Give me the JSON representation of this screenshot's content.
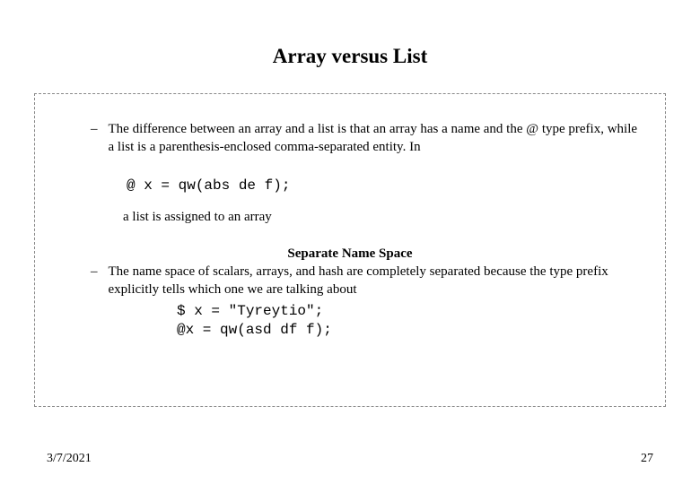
{
  "title": "Array versus List",
  "bullet1": {
    "dash": "–",
    "text": "The difference between an array and a list is that an array has a name and the @ type prefix, while a list is a parenthesis-enclosed comma-separated entity. In"
  },
  "code1": "@ x = qw(abs de f);",
  "subtext1": "a list is assigned to an array",
  "subheading": "Separate Name Space",
  "bullet2": {
    "dash": "–",
    "text": "The name space of scalars, arrays, and hash are completely separated because the type prefix explicitly tells which one we are talking about"
  },
  "code2_line1": "$ x = \"Tyreytio\";",
  "code2_line2": "@x = qw(asd df f);",
  "footer": {
    "date": "3/7/2021",
    "page": "27"
  }
}
